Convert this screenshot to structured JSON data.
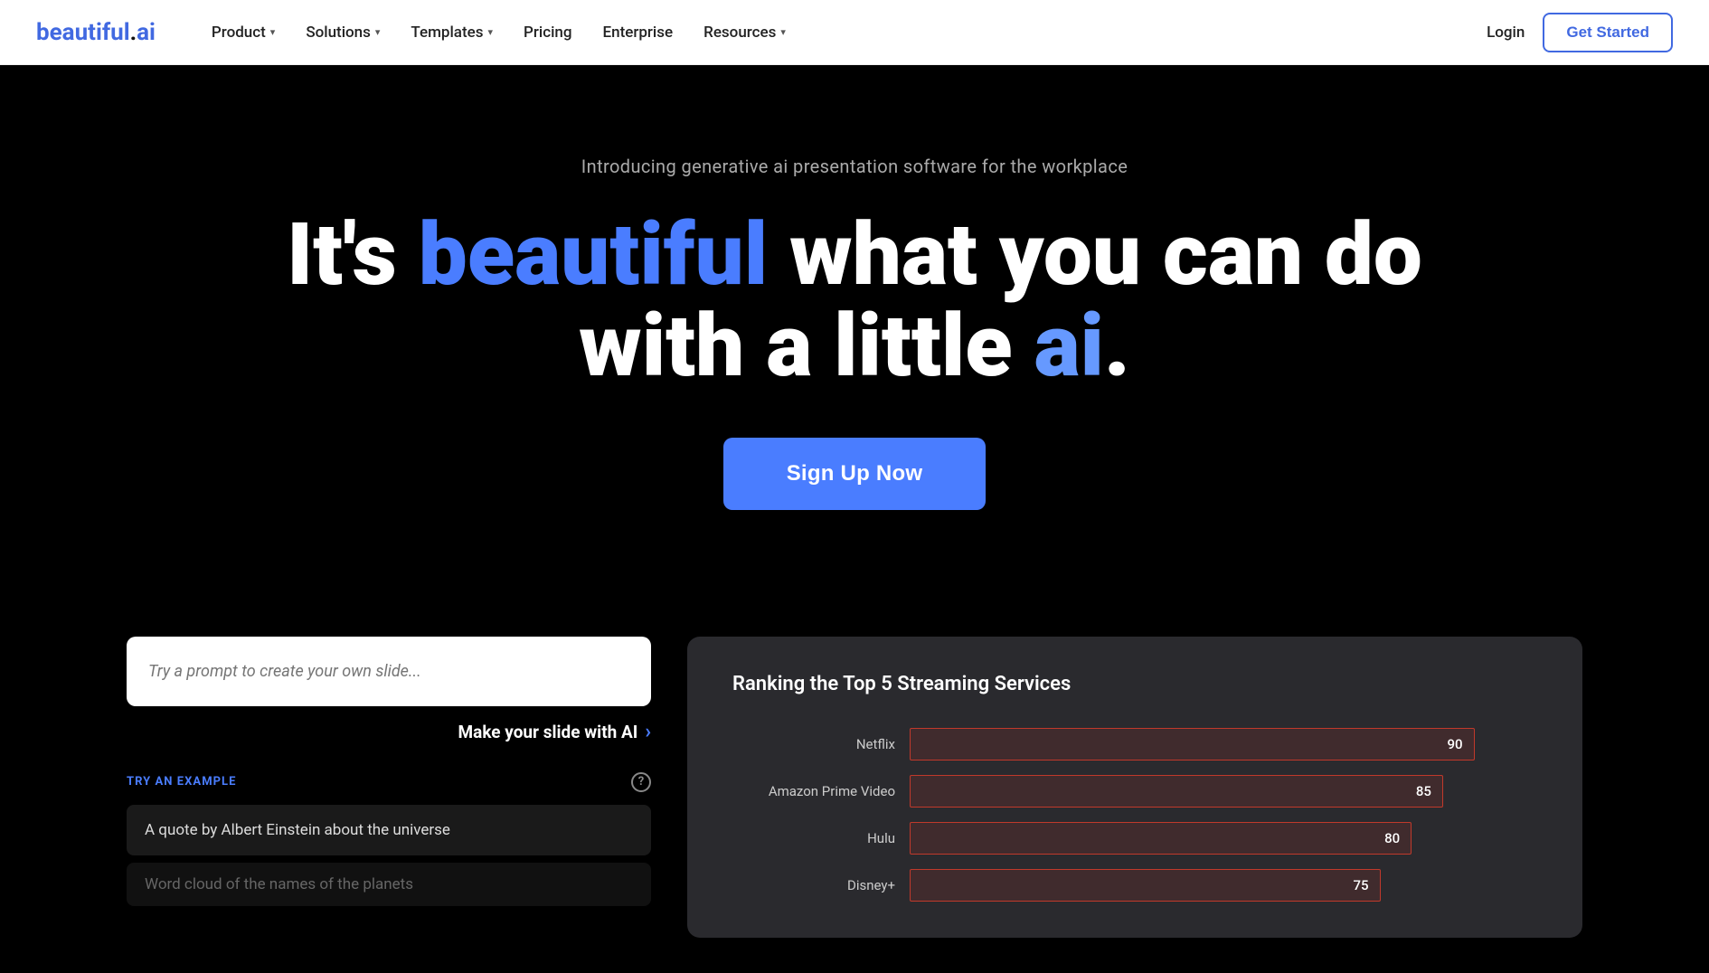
{
  "nav": {
    "logo_text": "beautiful",
    "logo_dot": ".",
    "logo_ai": "ai",
    "items": [
      {
        "label": "Product",
        "has_dropdown": true
      },
      {
        "label": "Solutions",
        "has_dropdown": true
      },
      {
        "label": "Templates",
        "has_dropdown": true
      },
      {
        "label": "Pricing",
        "has_dropdown": false
      },
      {
        "label": "Enterprise",
        "has_dropdown": false
      },
      {
        "label": "Resources",
        "has_dropdown": true
      }
    ],
    "login_label": "Login",
    "get_started_label": "Get Started"
  },
  "hero": {
    "subtitle": "Introducing generative ai presentation software for the workplace",
    "headline_part1": "It's ",
    "headline_beautiful": "beautiful",
    "headline_part2": " what you can do",
    "headline_part3": "with a little ",
    "headline_ai": "ai",
    "headline_dot": ".",
    "cta_label": "Sign Up Now"
  },
  "prompt_section": {
    "input_placeholder": "Try a prompt to create your own slide...",
    "make_slide_label": "Make your slide with AI",
    "try_example_label": "TRY AN EXAMPLE",
    "help_icon": "?",
    "examples": [
      {
        "text": "A quote by Albert Einstein about the universe"
      },
      {
        "text": "Word cloud of the names of the planets"
      }
    ]
  },
  "chart": {
    "title": "Ranking the Top 5 Streaming Services",
    "rows": [
      {
        "label": "Netflix",
        "value": 90,
        "max": 100
      },
      {
        "label": "Amazon Prime Video",
        "value": 85,
        "max": 100
      },
      {
        "label": "Hulu",
        "value": 80,
        "max": 100
      },
      {
        "label": "Disney+",
        "value": 75,
        "max": 100
      }
    ]
  }
}
